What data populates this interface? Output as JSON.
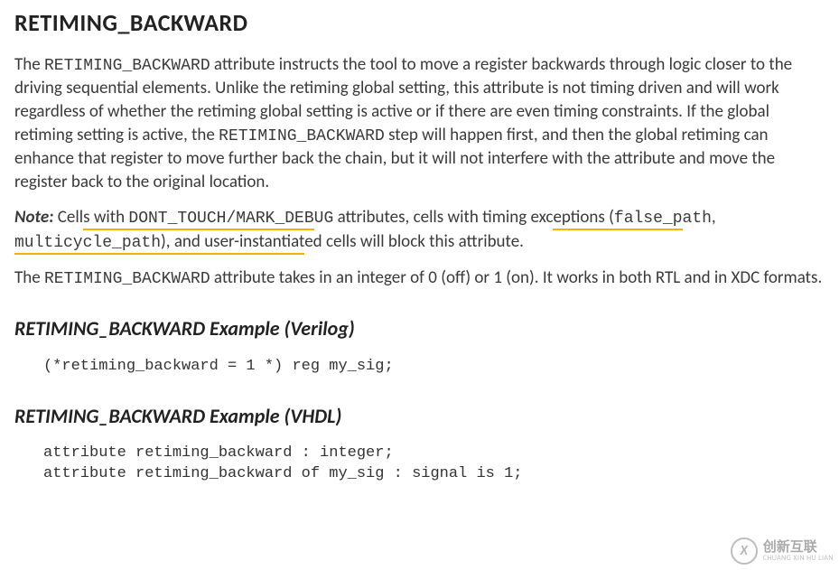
{
  "title": "RETIMING_BACKWARD",
  "para1": {
    "t1": "The ",
    "c1": "RETIMING_BACKWARD",
    "t2": " attribute instructs the tool to move a register backwards through logic closer to the driving sequential elements. Unlike the retiming global setting, this attribute is not timing driven and will work regardless of whether the retiming global setting is active or if there are even timing constraints. If the global retiming setting is active, the ",
    "c2": "RETIMING_BACKWARD",
    "t3": " step will happen first, and then the global retiming can enhance that register to move further back the chain, but it will not interfere with the attribute and move the register back to the original location."
  },
  "note": {
    "label": "Note:",
    "sp": "  ",
    "t1": "Cell",
    "h1": "s with ",
    "c1a": "DONT_TOUCH",
    "slash": "/",
    "c1b": "MARK_DEB",
    "c1c": "UG",
    "t2": " attributes, cells with timing exc",
    "h2": "eptions (",
    "c2a": "false_p",
    "c2b": "ath",
    "comma": ", ",
    "c3a": "multicycle_path",
    "t3a": "), and user-instantiat",
    "t3b": "ed cells will block this attribute."
  },
  "para2": {
    "t1": "The ",
    "c1": "RETIMING_BACKWARD",
    "t2": " attribute takes in an integer of 0 (off) or 1 (on). It works in both RTL and in XDC formats."
  },
  "example_verilog": {
    "heading": "RETIMING_BACKWARD Example (Verilog)",
    "code": "(*retiming_backward = 1 *) reg my_sig;"
  },
  "example_vhdl": {
    "heading": "RETIMING_BACKWARD Example (VHDL)",
    "code": "attribute retiming_backward : integer;\nattribute retiming_backward of my_sig : signal is 1;"
  },
  "watermark": {
    "badge": "X",
    "cn": "创新互联",
    "py": "CHUANG XIN HU LIAN"
  }
}
